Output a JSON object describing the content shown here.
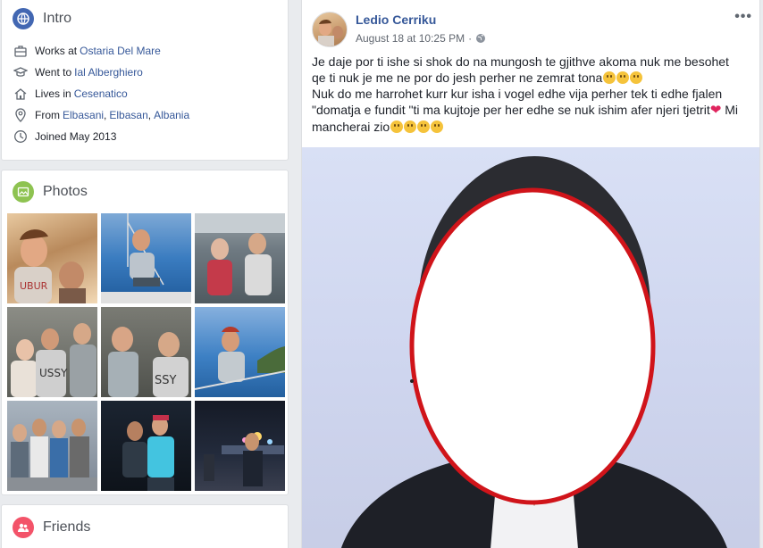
{
  "intro": {
    "title": "Intro",
    "rows": [
      {
        "prefix": "Works at",
        "link": "Ostaria Del Mare",
        "icon": "briefcase-icon"
      },
      {
        "prefix": "Went to",
        "link": "Ial Alberghiero",
        "icon": "graduation-cap-icon"
      },
      {
        "prefix": "Lives in",
        "link": "Cesenatico",
        "icon": "home-icon"
      },
      {
        "prefix": "From",
        "link1": "Elbasani",
        "sep1": ",",
        "link2": "Elbasan",
        "sep2": ",",
        "link3": "Albania",
        "icon": "location-pin-icon"
      },
      {
        "text": "Joined May 2013",
        "icon": "clock-icon"
      }
    ],
    "icon": "globe-icon",
    "accent": "#4267b2"
  },
  "photos": {
    "title": "Photos",
    "icon": "photo-icon",
    "accent": "#8ec351"
  },
  "friends": {
    "title": "Friends",
    "icon": "friends-icon",
    "accent": "#f35369"
  },
  "post": {
    "author": "Ledio Cerriku",
    "timestamp": "August 18 at 10:25 PM",
    "privacy_icon": "globe-icon",
    "more_label": "•••",
    "line1": "Je daje por ti ishe si shok do na mungosh te gjithve akoma nuk me besohet",
    "line2": "qe ti nuk je me ne por do jesh perher ne zemrat tona",
    "line3": "Nuk do me harrohet kurr kur isha i vogel edhe vija perher tek ti edhe fjalen",
    "line4": "\"domatja e fundit \"ti ma kujtoje per her edhe se nuk ishim afer njeri tjetrit",
    "line5": "Mi mancherai zio",
    "link_color": "#365899"
  }
}
